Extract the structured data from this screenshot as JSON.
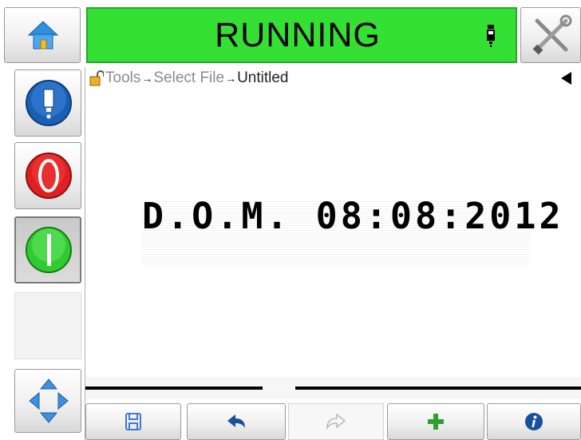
{
  "status": {
    "text": "RUNNING",
    "color": "#35e035"
  },
  "breadcrumb": {
    "part1": "Tools",
    "sep1": "→",
    "part2": "Select File",
    "sep2": "→",
    "part3": "Untitled"
  },
  "message": {
    "text": "D.O.M. 08:08:2012"
  },
  "icons": {
    "home": "home-icon",
    "tools": "tools-icon",
    "ink": "ink-bottle-icon",
    "stop": "stop-icon",
    "start": "start-icon",
    "navigate": "navigate-arrows-icon",
    "lock": "lock-icon",
    "back": "back-triangle-icon",
    "save": "save-icon",
    "undo": "undo-icon",
    "redo": "redo-icon",
    "add": "add-icon",
    "info": "info-icon"
  },
  "colors": {
    "stop": "#e02020",
    "start": "#2ecc2e",
    "ink": "#1a5fb4",
    "add": "#2fa02f",
    "info": "#1a4fa0"
  }
}
